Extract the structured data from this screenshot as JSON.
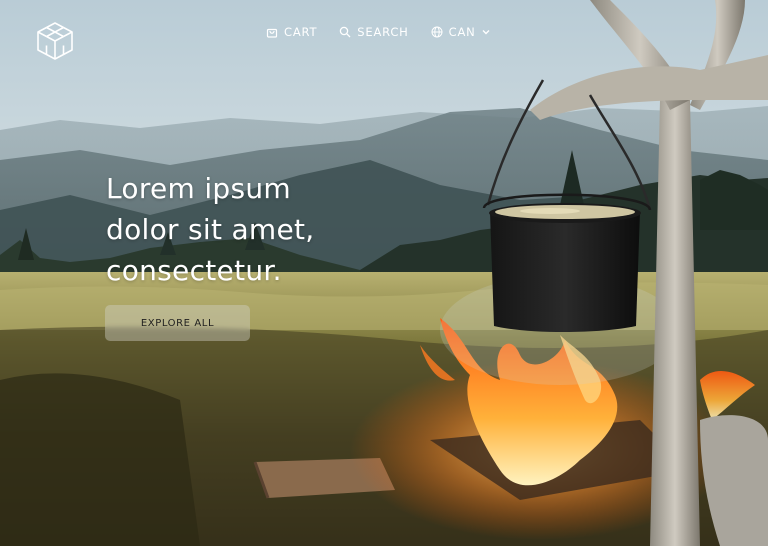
{
  "brand": {
    "logo_icon": "cube-logo-icon"
  },
  "nav": {
    "items": [
      {
        "label": "CART",
        "icon": "bag-icon"
      },
      {
        "label": "SEARCH",
        "icon": "search-icon"
      },
      {
        "label": "CAN",
        "icon": "globe-icon",
        "dropdown_icon": "chevron-down-icon"
      }
    ]
  },
  "hero": {
    "headline_lines": [
      "Lorem ipsum",
      "dolor sit amet,",
      "consectetur."
    ],
    "cta_label": "EXPLORE ALL"
  },
  "colors": {
    "text": "#ffffff",
    "cta_background": "#d2d2c8",
    "cta_text": "#1f1f1f"
  }
}
